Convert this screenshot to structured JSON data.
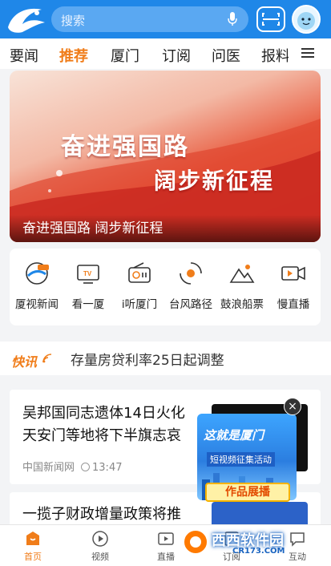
{
  "header": {
    "search_placeholder": "搜索",
    "accent": "#1f87e8"
  },
  "tabs": [
    {
      "label": "要闻"
    },
    {
      "label": "推荐",
      "active": true
    },
    {
      "label": "厦门"
    },
    {
      "label": "订阅"
    },
    {
      "label": "问医"
    },
    {
      "label": "报料"
    }
  ],
  "banner": {
    "headline1": "奋进强国路",
    "headline2": "阔步新征程",
    "caption": "奋进强国路 阔步新征程"
  },
  "shortcuts": [
    {
      "label": "厦视新闻",
      "icon": "news-globe-icon"
    },
    {
      "label": "看一厦",
      "icon": "tv-icon"
    },
    {
      "label": "i听厦门",
      "icon": "radio-icon"
    },
    {
      "label": "台风路径",
      "icon": "typhoon-icon"
    },
    {
      "label": "鼓浪船票",
      "icon": "mountain-icon"
    },
    {
      "label": "慢直播",
      "icon": "video-camera-icon"
    }
  ],
  "flash": {
    "badge": "快讯",
    "text": "存量房贷利率25日起调整"
  },
  "news": [
    {
      "title_line1": "吴邦国同志遗体14日火化",
      "title_line2": "天安门等地将下半旗志哀",
      "source": "中国新闻网",
      "time": "13:47"
    },
    {
      "title_line1": "一揽子财政增量政策将推"
    }
  ],
  "ad": {
    "title": "这就是厦门",
    "subtitle": "短视频征集活动",
    "button": "作品展播",
    "close": "×"
  },
  "bottom_nav": [
    {
      "label": "首页",
      "icon": "home-icon",
      "active": true
    },
    {
      "label": "视频",
      "icon": "play-icon"
    },
    {
      "label": "直播",
      "icon": "live-icon"
    },
    {
      "label": "订阅",
      "icon": "subscribe-icon"
    },
    {
      "label": "互动",
      "icon": "chat-icon"
    }
  ],
  "watermark": {
    "text": "西西软件园",
    "sub": "CR173.COM"
  }
}
